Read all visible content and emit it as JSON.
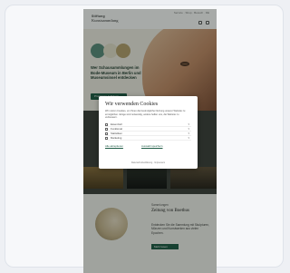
{
  "brand": {
    "name": "Stiftung",
    "subtitle": "Kunstsammlung"
  },
  "header": {
    "nav_text": "Service · Shop · Besuch · DE"
  },
  "hero": {
    "colors": [
      "#5b8d7d",
      "#e7e1cd",
      "#b7a26e"
    ],
    "text": "Wer Schausammlungen im Bode-Museum in Berlin und Museumsinsel entdecken",
    "button": "Programm & Tickets"
  },
  "cookie": {
    "title": "Wir verwenden Cookies",
    "description": "Wir nutzen Cookies, um Ihnen die bestmögliche Nutzung unserer Website zu ermöglichen. Einige sind notwendig, andere helfen uns, die Website zu verbessern.",
    "options": [
      {
        "label": "Essenziell",
        "checked": true
      },
      {
        "label": "Funktional",
        "checked": false
      },
      {
        "label": "Statistiken",
        "checked": false
      },
      {
        "label": "Marketing",
        "checked": false
      }
    ],
    "accept_all": "Alle akzeptieren",
    "save": "Auswahl speichern",
    "footer": "Datenschutzerklärung · Impressum"
  },
  "section2": {
    "label": "Sammlungen",
    "title": "Zeitung von Boethus",
    "text": "Entdecken Sie die Sammlung mit Skulpturen, Münzen und Kunstwerken aus vielen Epochen.",
    "button": "Mehr lesen"
  }
}
